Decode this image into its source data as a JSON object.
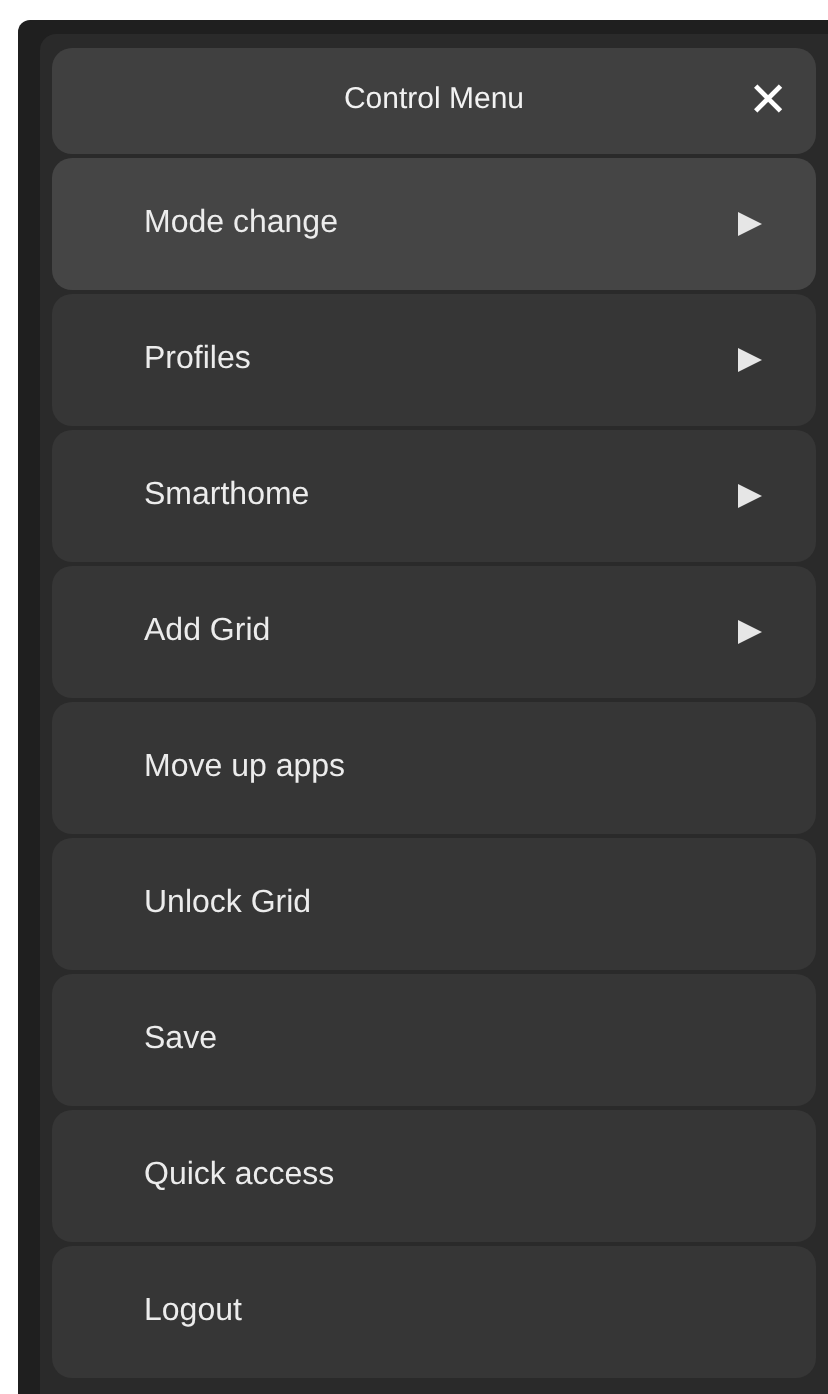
{
  "header": {
    "title": "Control Menu",
    "close": "✕"
  },
  "items": [
    {
      "label": "Mode change",
      "submenu": true,
      "selected": true
    },
    {
      "label": "Profiles",
      "submenu": true,
      "selected": false
    },
    {
      "label": "Smarthome",
      "submenu": true,
      "selected": false
    },
    {
      "label": "Add Grid",
      "submenu": true,
      "selected": false
    },
    {
      "label": "Move up apps",
      "submenu": false,
      "selected": false
    },
    {
      "label": "Unlock Grid",
      "submenu": false,
      "selected": false
    },
    {
      "label": "Save",
      "submenu": false,
      "selected": false
    },
    {
      "label": "Quick access",
      "submenu": false,
      "selected": false
    },
    {
      "label": "Logout",
      "submenu": false,
      "selected": false
    }
  ]
}
